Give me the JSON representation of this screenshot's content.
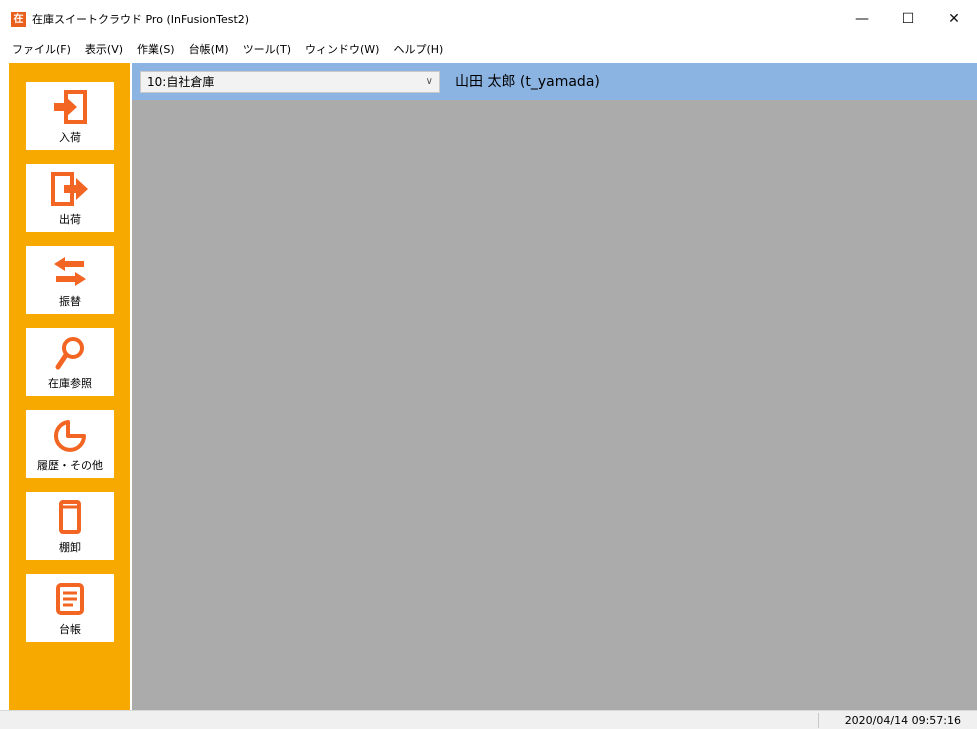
{
  "window": {
    "app_icon_char": "在",
    "title": "在庫スイートクラウド Pro (InFusionTest2)",
    "minimize_glyph": "—",
    "maximize_glyph": "☐",
    "close_glyph": "✕"
  },
  "menu": [
    {
      "label": "ファイル(F)"
    },
    {
      "label": "表示(V)"
    },
    {
      "label": "作業(S)"
    },
    {
      "label": "台帳(M)"
    },
    {
      "label": "ツール(T)"
    },
    {
      "label": "ウィンドウ(W)"
    },
    {
      "label": "ヘルプ(H)"
    }
  ],
  "sidebar": {
    "accent_color": "#f7a900",
    "icon_color": "#f26522",
    "items": [
      {
        "label": "入荷",
        "icon": "arrival-icon"
      },
      {
        "label": "出荷",
        "icon": "shipment-icon"
      },
      {
        "label": "振替",
        "icon": "transfer-icon"
      },
      {
        "label": "在庫参照",
        "icon": "search-icon"
      },
      {
        "label": "履歴・その他",
        "icon": "history-icon"
      },
      {
        "label": "棚卸",
        "icon": "inventory-icon"
      },
      {
        "label": "台帳",
        "icon": "ledger-icon"
      }
    ]
  },
  "header": {
    "warehouse_selected": "10:自社倉庫",
    "user": "山田 太郎 (t_yamada)",
    "background_color": "#8cb4e2"
  },
  "status": {
    "datetime": "2020/04/14  09:57:16"
  }
}
